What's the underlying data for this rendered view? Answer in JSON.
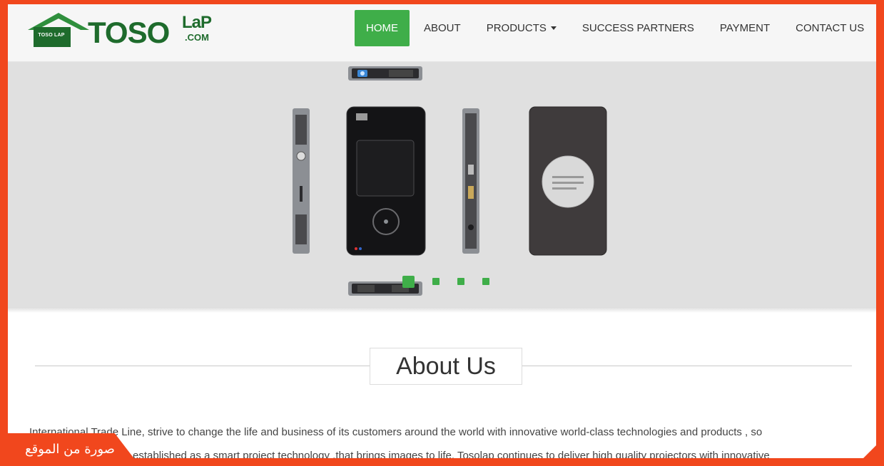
{
  "header": {
    "logo": {
      "badge_text": "TOSO LAP",
      "word": "TOSO",
      "sup": "LaP",
      "sub": ".COM"
    },
    "nav": [
      {
        "label": "HOME",
        "active": true,
        "dropdown": false
      },
      {
        "label": "ABOUT",
        "active": false,
        "dropdown": false
      },
      {
        "label": "PRODUCTS",
        "active": false,
        "dropdown": true
      },
      {
        "label": "SUCCESS PARTNERS",
        "active": false,
        "dropdown": false
      },
      {
        "label": "PAYMENT",
        "active": false,
        "dropdown": false
      },
      {
        "label": "CONTACT US",
        "active": false,
        "dropdown": false
      }
    ]
  },
  "hero": {
    "slides_count": 4,
    "active_slide": 1
  },
  "about": {
    "title": "About Us",
    "line1": "International Trade Line, strive to change the life and business of its customers around the world with innovative world-class technologies and products , so",
    "line2": "established as a smart project technology ,that brings images to life. Tosolap continues to deliver high quality projectors with innovative"
  },
  "caption": "صورة من الموقع",
  "colors": {
    "brand_green": "#3fae49",
    "logo_green": "#1e6b2c",
    "frame_orange": "#f1471d"
  }
}
